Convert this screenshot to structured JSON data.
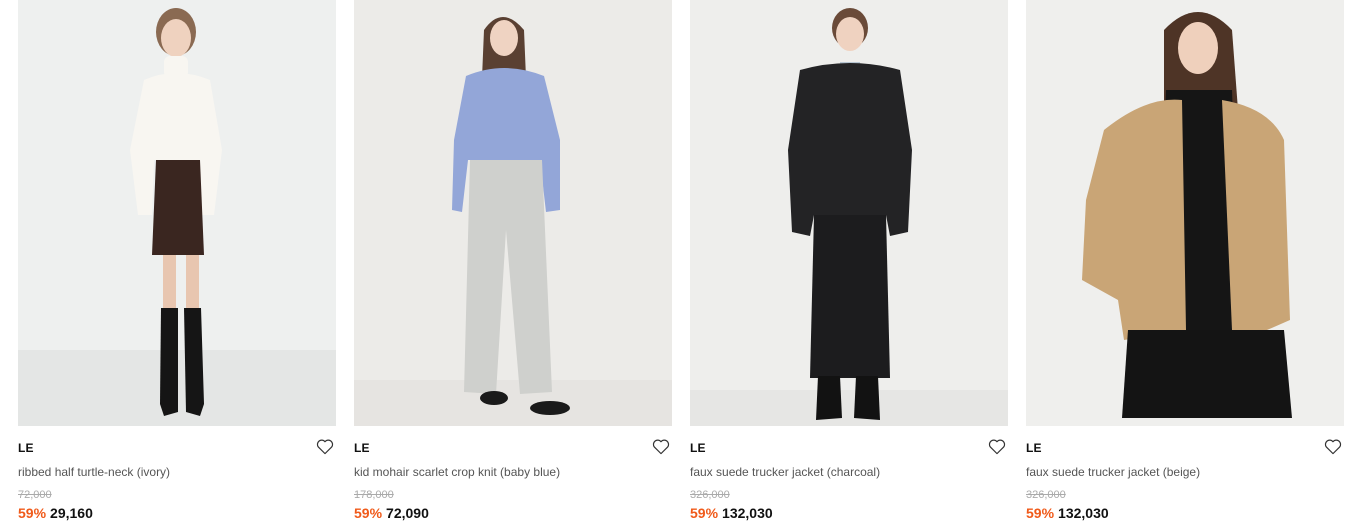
{
  "colors": {
    "discount": "#f05a1a",
    "text": "#111111",
    "muted": "#aaaaaa"
  },
  "products": [
    {
      "brand": "LE",
      "name": "ribbed half turtle-neck (ivory)",
      "original_price": "72,000",
      "discount": "59%",
      "price": "29,160",
      "image_alt": "model wearing ivory ribbed turtle-neck, brown mini skirt, black knee boots"
    },
    {
      "brand": "LE",
      "name": "kid mohair scarlet crop knit (baby blue)",
      "original_price": "178,000",
      "discount": "59%",
      "price": "72,090",
      "image_alt": "model wearing baby blue mohair crop knit and light grey cargo pants"
    },
    {
      "brand": "LE",
      "name": "faux suede trucker jacket (charcoal)",
      "original_price": "326,000",
      "discount": "59%",
      "price": "132,030",
      "image_alt": "model wearing charcoal faux suede trucker jacket and black long skirt"
    },
    {
      "brand": "LE",
      "name": "faux suede trucker jacket (beige)",
      "original_price": "326,000",
      "discount": "59%",
      "price": "132,030",
      "image_alt": "model wearing beige faux suede trucker jacket over black turtle-neck"
    }
  ],
  "icons": {
    "wishlist": "heart-icon"
  }
}
